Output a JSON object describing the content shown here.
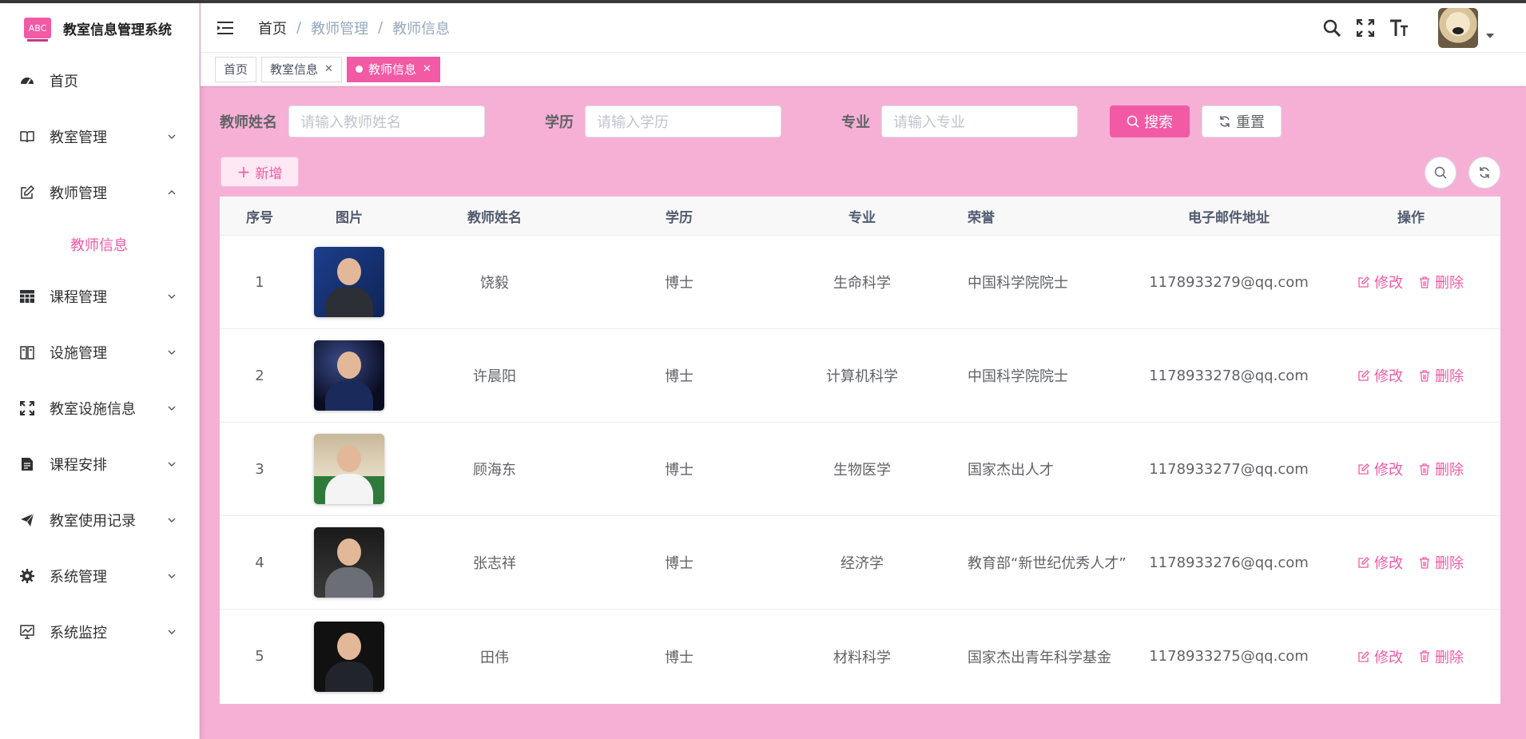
{
  "app": {
    "logo_text": "ABC",
    "title": "教室信息管理系统"
  },
  "sidebar": {
    "items": [
      {
        "label": "首页",
        "icon": "dashboard-icon",
        "has_arrow": false
      },
      {
        "label": "教室管理",
        "icon": "book-icon",
        "has_arrow": true
      },
      {
        "label": "教师管理",
        "icon": "edit-icon",
        "has_arrow": true,
        "expanded": true
      },
      {
        "label": "课程管理",
        "icon": "table-icon",
        "has_arrow": true
      },
      {
        "label": "设施管理",
        "icon": "building-icon",
        "has_arrow": true
      },
      {
        "label": "教室设施信息",
        "icon": "fullscreen-icon",
        "has_arrow": true
      },
      {
        "label": "课程安排",
        "icon": "document-icon",
        "has_arrow": true
      },
      {
        "label": "教室使用记录",
        "icon": "send-icon",
        "has_arrow": true
      },
      {
        "label": "系统管理",
        "icon": "gear-icon",
        "has_arrow": true
      },
      {
        "label": "系统监控",
        "icon": "monitor-icon",
        "has_arrow": true
      }
    ],
    "sub_active": "教师信息"
  },
  "header": {
    "breadcrumb": [
      "首页",
      "教师管理",
      "教师信息"
    ],
    "separator": "/"
  },
  "tags": [
    {
      "label": "首页",
      "closable": false,
      "active": false
    },
    {
      "label": "教室信息",
      "closable": true,
      "active": false
    },
    {
      "label": "教师信息",
      "closable": true,
      "active": true
    }
  ],
  "search": {
    "name_label": "教师姓名",
    "name_placeholder": "请输入教师姓名",
    "edu_label": "学历",
    "edu_placeholder": "请输入学历",
    "major_label": "专业",
    "major_placeholder": "请输入专业",
    "search_btn": "搜索",
    "reset_btn": "重置"
  },
  "toolbar": {
    "add_btn": "新增"
  },
  "table": {
    "columns": [
      "序号",
      "图片",
      "教师姓名",
      "学历",
      "专业",
      "荣誉",
      "电子邮件地址",
      "操作"
    ],
    "rows": [
      {
        "index": "1",
        "name": "饶毅",
        "edu": "博士",
        "major": "生命科学",
        "honor": "中国科学院院士",
        "email": "1178933279@qq.com"
      },
      {
        "index": "2",
        "name": "许晨阳",
        "edu": "博士",
        "major": "计算机科学",
        "honor": "中国科学院院士",
        "email": "1178933278@qq.com"
      },
      {
        "index": "3",
        "name": "顾海东",
        "edu": "博士",
        "major": "生物医学",
        "honor": "国家杰出人才",
        "email": "1178933277@qq.com"
      },
      {
        "index": "4",
        "name": "张志祥",
        "edu": "博士",
        "major": "经济学",
        "honor": "教育部“新世纪优秀人才”",
        "email": "1178933276@qq.com"
      },
      {
        "index": "5",
        "name": "田伟",
        "edu": "博士",
        "major": "材料科学",
        "honor": "国家杰出青年科学基金",
        "email": "1178933275@qq.com"
      }
    ],
    "edit_label": "修改",
    "delete_label": "删除"
  },
  "colors": {
    "accent": "#f25aa5",
    "background": "#f6b0d6"
  }
}
